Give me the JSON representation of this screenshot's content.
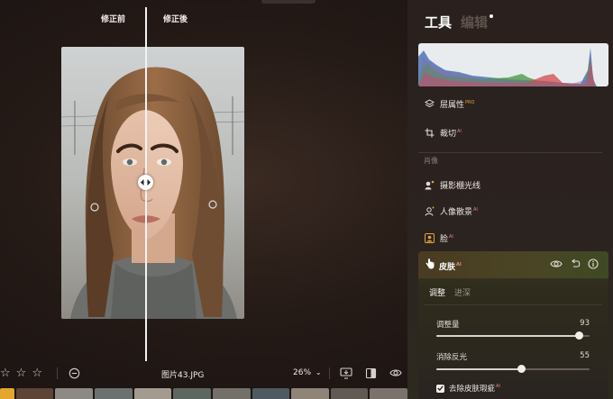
{
  "compare": {
    "before_label": "修正前",
    "after_label": "修正後"
  },
  "photo": {
    "subject": "portrait-woman"
  },
  "bottom_toolbar": {
    "rating_stars": 3,
    "filename": "图片43.JPG",
    "zoom": "26%",
    "zoom_chevron": "⌄"
  },
  "panel": {
    "tabs": {
      "tools": "工具",
      "edit": "编辑"
    },
    "menu": {
      "layer_properties": {
        "label": "层属性",
        "badge": "PRO"
      },
      "crop": {
        "label": "裁切",
        "badge": "AI"
      }
    },
    "section_portrait": "肖像",
    "portrait_items": {
      "studio_light": {
        "label": "摄影棚光线"
      },
      "portrait_bg": {
        "label": "人像散景",
        "badge": "AI"
      },
      "face": {
        "label": "脸",
        "badge": "AI"
      }
    },
    "skin": {
      "title": "皮肤",
      "badge": "AI",
      "subtabs": {
        "adjust": "调整",
        "advanced": "进深"
      },
      "sliders": [
        {
          "label": "调整量",
          "value": "93",
          "fraction": 0.93
        },
        {
          "label": "消除反光",
          "value": "55",
          "fraction": 0.55
        }
      ],
      "checkbox": {
        "label": "去除皮肤瑕疵",
        "badge": "AI",
        "checked": true
      }
    }
  },
  "colors": {
    "accent_orange": "#e0a33a",
    "panel_bg": "#2a211e",
    "skin_card": "#3c3a1f"
  }
}
